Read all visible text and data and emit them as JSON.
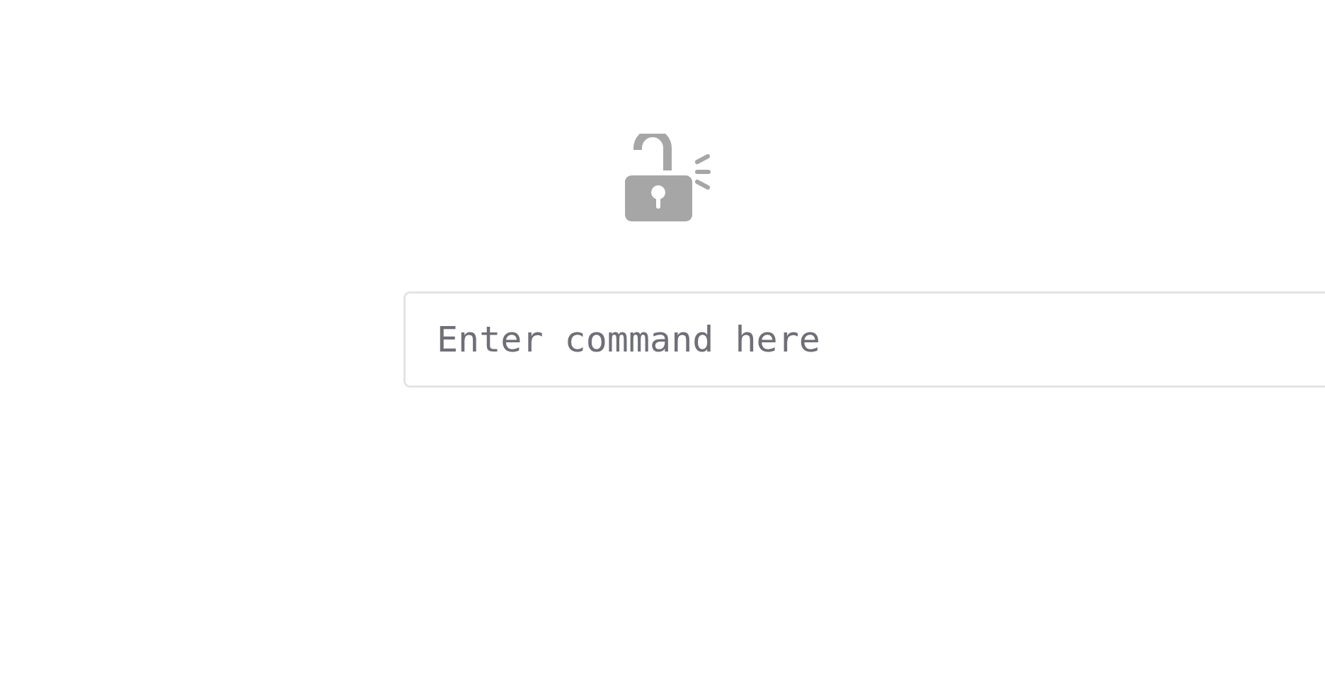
{
  "command_input": {
    "placeholder": "Enter command here"
  }
}
